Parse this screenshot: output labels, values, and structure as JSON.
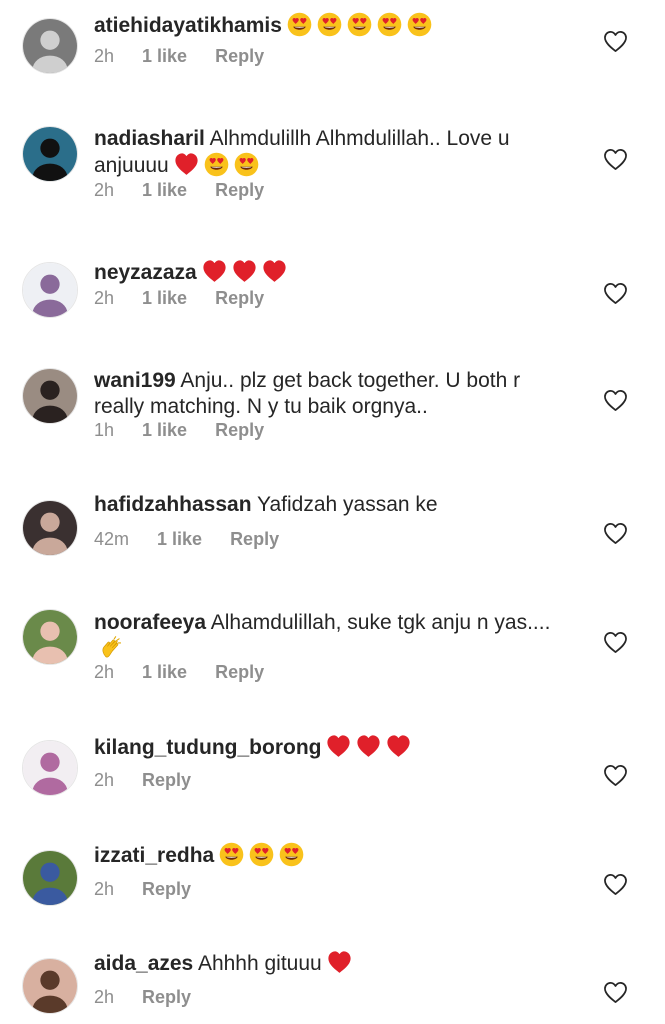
{
  "comments": [
    {
      "username": "atiehidayatikhamis",
      "text": "",
      "emojis": [
        "heart-eyes",
        "heart-eyes",
        "heart-eyes",
        "heart-eyes",
        "heart-eyes"
      ],
      "time": "2h",
      "likes": "1 like",
      "reply": "Reply",
      "avatar_colors": [
        "#7a7a7a",
        "#cfcfcf"
      ]
    },
    {
      "username": "nadiasharil",
      "text": "Alhmdulillh Alhmdulillah.. Love u anjuuuu",
      "emojis": [
        "red-heart",
        "heart-eyes",
        "heart-eyes"
      ],
      "time": "2h",
      "likes": "1 like",
      "reply": "Reply",
      "avatar_colors": [
        "#2b6e8a",
        "#111111"
      ]
    },
    {
      "username": "neyzazaza",
      "text": "",
      "emojis": [
        "red-heart",
        "red-heart",
        "red-heart"
      ],
      "time": "2h",
      "likes": "1 like",
      "reply": "Reply",
      "avatar_colors": [
        "#eef0f4",
        "#8a6a9a"
      ]
    },
    {
      "username": "wani199",
      "text": "Anju.. plz get back together. U both r really matching. N y tu baik orgnya..",
      "emojis": [],
      "time": "1h",
      "likes": "1 like",
      "reply": "Reply",
      "avatar_colors": [
        "#9a8c82",
        "#2a2220"
      ]
    },
    {
      "username": "hafidzahhassan",
      "text": "Yafidzah yassan ke",
      "emojis": [],
      "time": "42m",
      "likes": "1 like",
      "reply": "Reply",
      "avatar_colors": [
        "#3a3030",
        "#c9a89a"
      ]
    },
    {
      "username": "noorafeeya",
      "text": "Alhamdulillah, suke tgk anju n yas....",
      "emojis": [
        "clapping-hands"
      ],
      "time": "2h",
      "likes": "1 like",
      "reply": "Reply",
      "avatar_colors": [
        "#6a8a4a",
        "#e8c0b0"
      ]
    },
    {
      "username": "kilang_tudung_borong",
      "text": "",
      "emojis": [
        "red-heart",
        "red-heart",
        "red-heart"
      ],
      "time": "2h",
      "likes": "",
      "reply": "Reply",
      "avatar_colors": [
        "#f2eef2",
        "#b06aa0"
      ]
    },
    {
      "username": "izzati_redha",
      "text": "",
      "emojis": [
        "heart-eyes",
        "heart-eyes",
        "heart-eyes"
      ],
      "time": "2h",
      "likes": "",
      "reply": "Reply",
      "avatar_colors": [
        "#5a7a3a",
        "#3a5aa0"
      ]
    },
    {
      "username": "aida_azes",
      "text": "Ahhhh gituuu",
      "emojis": [
        "red-heart"
      ],
      "time": "2h",
      "likes": "",
      "reply": "Reply",
      "avatar_colors": [
        "#d8b0a0",
        "#5a3a2a"
      ]
    }
  ],
  "colors": {
    "text": "#262626",
    "meta": "#8e8e8e",
    "heart_outline": "#262626",
    "red_heart": "#e0202a",
    "emoji_face": "#f9c21b"
  }
}
